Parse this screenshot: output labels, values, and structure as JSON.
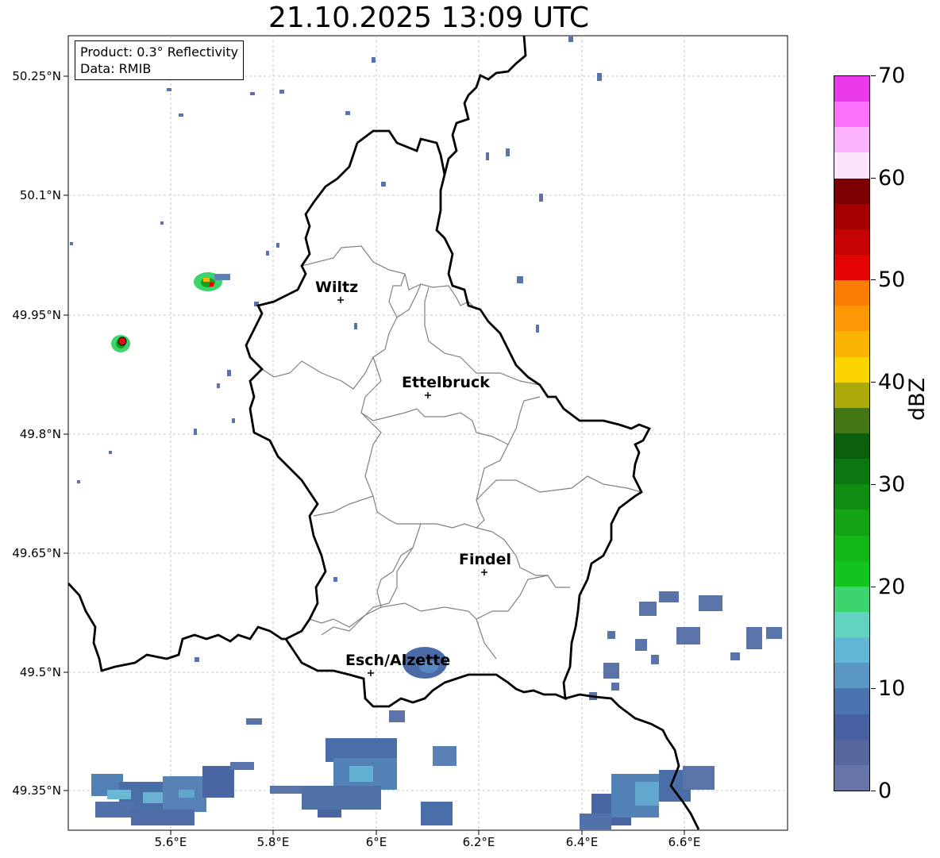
{
  "title": "21.10.2025 13:09 UTC",
  "info_box": {
    "product_line": "Product: 0.3° Reflectivity",
    "data_line": "Data: RMIB"
  },
  "axes": {
    "lat_ticks": [
      "50.25°N",
      "50.1°N",
      "49.95°N",
      "49.8°N",
      "49.65°N",
      "49.5°N",
      "49.35°N"
    ],
    "lon_ticks": [
      "5.6°E",
      "5.8°E",
      "6°E",
      "6.2°E",
      "6.4°E",
      "6.6°E"
    ]
  },
  "cities": [
    {
      "name": "Wiltz",
      "lon": 5.93,
      "lat": 49.97
    },
    {
      "name": "Ettelbruck",
      "lon": 6.1,
      "lat": 49.85
    },
    {
      "name": "Findel",
      "lon": 6.21,
      "lat": 49.63
    },
    {
      "name": "Esch/Alzette",
      "lon": 5.99,
      "lat": 49.5
    }
  ],
  "colorbar": {
    "label": "dBZ",
    "tick_labels": [
      "0",
      "10",
      "20",
      "30",
      "40",
      "50",
      "60",
      "70"
    ],
    "colors": [
      "#6674a8",
      "#56669e",
      "#4660a2",
      "#4a74b0",
      "#5a96c4",
      "#62b6d6",
      "#60d4c0",
      "#3cd46c",
      "#12c41e",
      "#12b616",
      "#12a414",
      "#108e12",
      "#0c7610",
      "#0a5e0c",
      "#447614",
      "#acaa0a",
      "#fcd400",
      "#fcb404",
      "#fc9804",
      "#fc7d04",
      "#e40404",
      "#c40202",
      "#a40000",
      "#7c0000",
      "#fce4fc",
      "#fcb2fc",
      "#fc72fc",
      "#ea3aea"
    ]
  },
  "colors": {
    "border": "#000000",
    "cantons": "#808080",
    "grid": "#b0b0b0",
    "radar_red": "#e01010"
  }
}
